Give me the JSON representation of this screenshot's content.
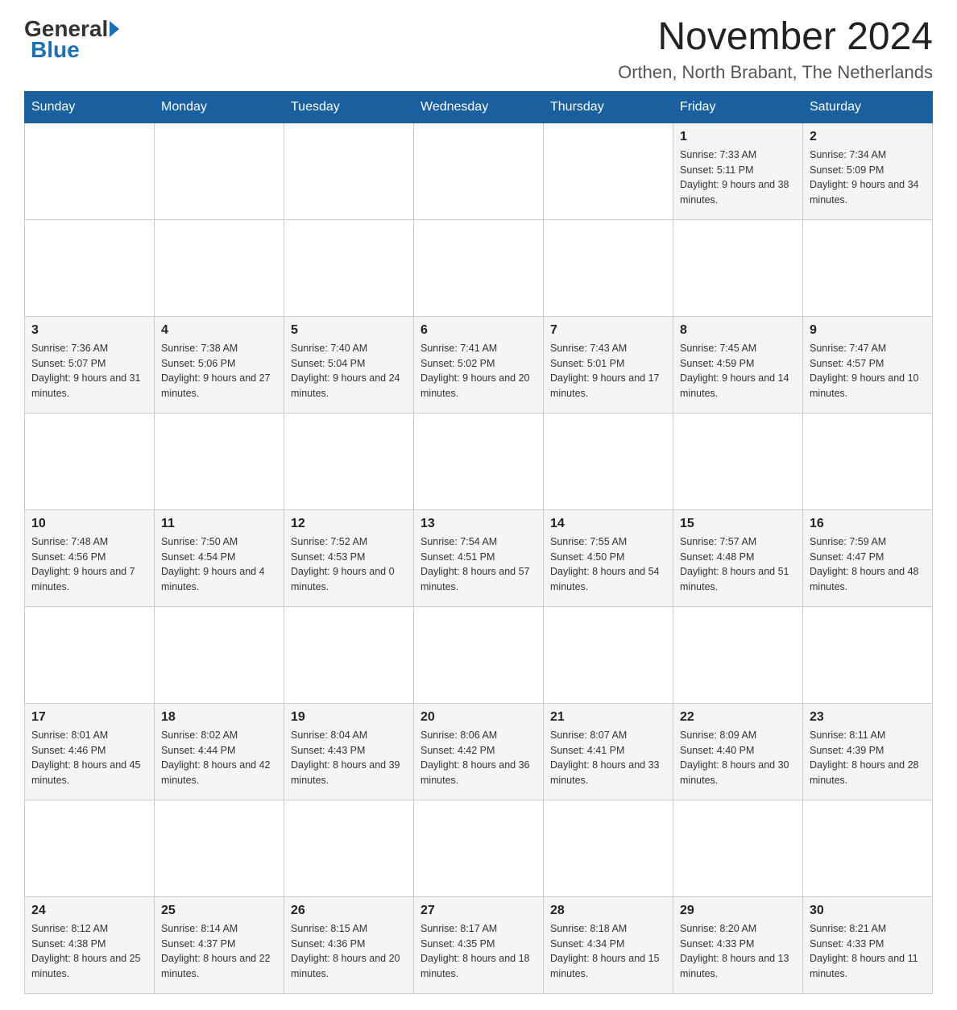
{
  "logo": {
    "general": "General",
    "blue": "Blue"
  },
  "title": {
    "month_year": "November 2024",
    "location": "Orthen, North Brabant, The Netherlands"
  },
  "weekdays": [
    "Sunday",
    "Monday",
    "Tuesday",
    "Wednesday",
    "Thursday",
    "Friday",
    "Saturday"
  ],
  "weeks": [
    [
      {
        "day": "",
        "detail": ""
      },
      {
        "day": "",
        "detail": ""
      },
      {
        "day": "",
        "detail": ""
      },
      {
        "day": "",
        "detail": ""
      },
      {
        "day": "",
        "detail": ""
      },
      {
        "day": "1",
        "detail": "Sunrise: 7:33 AM\nSunset: 5:11 PM\nDaylight: 9 hours and 38 minutes."
      },
      {
        "day": "2",
        "detail": "Sunrise: 7:34 AM\nSunset: 5:09 PM\nDaylight: 9 hours and 34 minutes."
      }
    ],
    [
      {
        "day": "3",
        "detail": "Sunrise: 7:36 AM\nSunset: 5:07 PM\nDaylight: 9 hours and 31 minutes."
      },
      {
        "day": "4",
        "detail": "Sunrise: 7:38 AM\nSunset: 5:06 PM\nDaylight: 9 hours and 27 minutes."
      },
      {
        "day": "5",
        "detail": "Sunrise: 7:40 AM\nSunset: 5:04 PM\nDaylight: 9 hours and 24 minutes."
      },
      {
        "day": "6",
        "detail": "Sunrise: 7:41 AM\nSunset: 5:02 PM\nDaylight: 9 hours and 20 minutes."
      },
      {
        "day": "7",
        "detail": "Sunrise: 7:43 AM\nSunset: 5:01 PM\nDaylight: 9 hours and 17 minutes."
      },
      {
        "day": "8",
        "detail": "Sunrise: 7:45 AM\nSunset: 4:59 PM\nDaylight: 9 hours and 14 minutes."
      },
      {
        "day": "9",
        "detail": "Sunrise: 7:47 AM\nSunset: 4:57 PM\nDaylight: 9 hours and 10 minutes."
      }
    ],
    [
      {
        "day": "10",
        "detail": "Sunrise: 7:48 AM\nSunset: 4:56 PM\nDaylight: 9 hours and 7 minutes."
      },
      {
        "day": "11",
        "detail": "Sunrise: 7:50 AM\nSunset: 4:54 PM\nDaylight: 9 hours and 4 minutes."
      },
      {
        "day": "12",
        "detail": "Sunrise: 7:52 AM\nSunset: 4:53 PM\nDaylight: 9 hours and 0 minutes."
      },
      {
        "day": "13",
        "detail": "Sunrise: 7:54 AM\nSunset: 4:51 PM\nDaylight: 8 hours and 57 minutes."
      },
      {
        "day": "14",
        "detail": "Sunrise: 7:55 AM\nSunset: 4:50 PM\nDaylight: 8 hours and 54 minutes."
      },
      {
        "day": "15",
        "detail": "Sunrise: 7:57 AM\nSunset: 4:48 PM\nDaylight: 8 hours and 51 minutes."
      },
      {
        "day": "16",
        "detail": "Sunrise: 7:59 AM\nSunset: 4:47 PM\nDaylight: 8 hours and 48 minutes."
      }
    ],
    [
      {
        "day": "17",
        "detail": "Sunrise: 8:01 AM\nSunset: 4:46 PM\nDaylight: 8 hours and 45 minutes."
      },
      {
        "day": "18",
        "detail": "Sunrise: 8:02 AM\nSunset: 4:44 PM\nDaylight: 8 hours and 42 minutes."
      },
      {
        "day": "19",
        "detail": "Sunrise: 8:04 AM\nSunset: 4:43 PM\nDaylight: 8 hours and 39 minutes."
      },
      {
        "day": "20",
        "detail": "Sunrise: 8:06 AM\nSunset: 4:42 PM\nDaylight: 8 hours and 36 minutes."
      },
      {
        "day": "21",
        "detail": "Sunrise: 8:07 AM\nSunset: 4:41 PM\nDaylight: 8 hours and 33 minutes."
      },
      {
        "day": "22",
        "detail": "Sunrise: 8:09 AM\nSunset: 4:40 PM\nDaylight: 8 hours and 30 minutes."
      },
      {
        "day": "23",
        "detail": "Sunrise: 8:11 AM\nSunset: 4:39 PM\nDaylight: 8 hours and 28 minutes."
      }
    ],
    [
      {
        "day": "24",
        "detail": "Sunrise: 8:12 AM\nSunset: 4:38 PM\nDaylight: 8 hours and 25 minutes."
      },
      {
        "day": "25",
        "detail": "Sunrise: 8:14 AM\nSunset: 4:37 PM\nDaylight: 8 hours and 22 minutes."
      },
      {
        "day": "26",
        "detail": "Sunrise: 8:15 AM\nSunset: 4:36 PM\nDaylight: 8 hours and 20 minutes."
      },
      {
        "day": "27",
        "detail": "Sunrise: 8:17 AM\nSunset: 4:35 PM\nDaylight: 8 hours and 18 minutes."
      },
      {
        "day": "28",
        "detail": "Sunrise: 8:18 AM\nSunset: 4:34 PM\nDaylight: 8 hours and 15 minutes."
      },
      {
        "day": "29",
        "detail": "Sunrise: 8:20 AM\nSunset: 4:33 PM\nDaylight: 8 hours and 13 minutes."
      },
      {
        "day": "30",
        "detail": "Sunrise: 8:21 AM\nSunset: 4:33 PM\nDaylight: 8 hours and 11 minutes."
      }
    ]
  ]
}
